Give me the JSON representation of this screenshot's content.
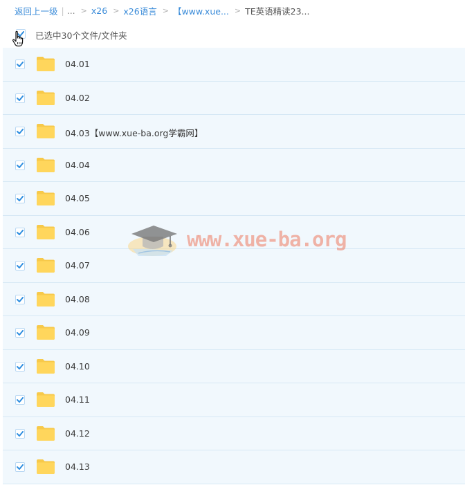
{
  "breadcrumb": {
    "back": "返回上一级",
    "ellipsis": "...",
    "separator": ">",
    "crumbs": [
      "x26",
      "x26语言",
      "【www.xue..."
    ],
    "current": "TE英语精读23..."
  },
  "selection": {
    "status": "已选中30个文件/文件夹",
    "all_checked": true
  },
  "files": [
    {
      "name": "04.01",
      "checked": true
    },
    {
      "name": "04.02",
      "checked": true
    },
    {
      "name": "04.03【www.xue-ba.org学霸网】",
      "checked": true
    },
    {
      "name": "04.04",
      "checked": true
    },
    {
      "name": "04.05",
      "checked": true
    },
    {
      "name": "04.06",
      "checked": true
    },
    {
      "name": "04.07",
      "checked": true
    },
    {
      "name": "04.08",
      "checked": true
    },
    {
      "name": "04.09",
      "checked": true
    },
    {
      "name": "04.10",
      "checked": true
    },
    {
      "name": "04.11",
      "checked": true
    },
    {
      "name": "04.12",
      "checked": true
    },
    {
      "name": "04.13",
      "checked": true
    }
  ],
  "watermark": {
    "text": "www.xue-ba.org",
    "icon": "graduation-cap-logo"
  },
  "icons": {
    "row_icon": "folder-icon",
    "check": "checkmark-icon",
    "cursor": "hand-pointer-icon"
  },
  "colors": {
    "link": "#3b8cd9",
    "row_background": "#f1f8fd",
    "row_border": "#d6e8f5",
    "checkbox_check": "#2e8ee0",
    "folder": "#ffd65c",
    "watermark": "#ec785f"
  }
}
